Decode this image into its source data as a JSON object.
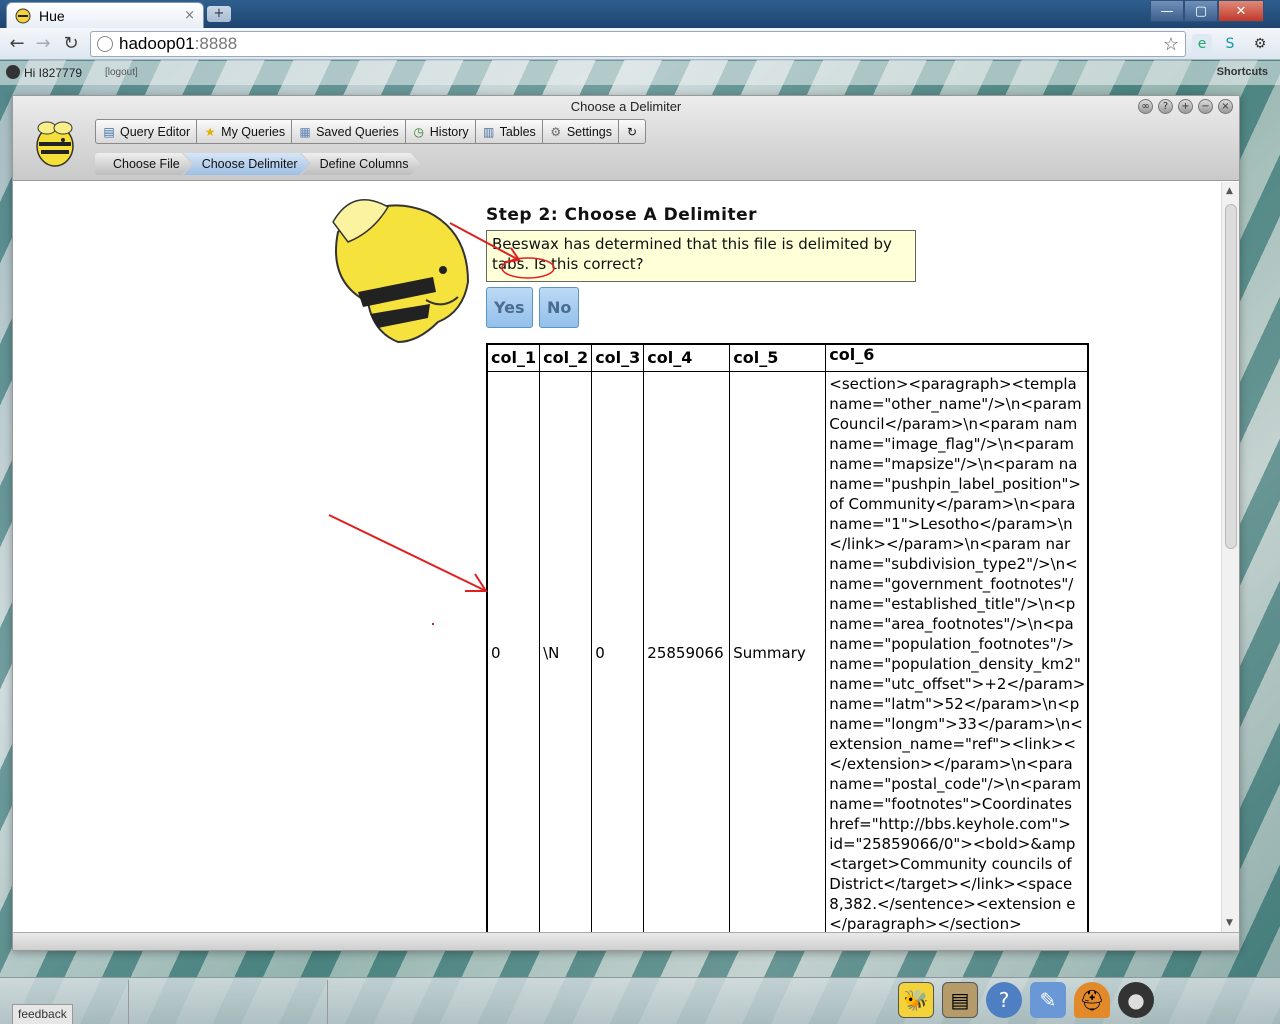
{
  "browser": {
    "tab_title": "Hue",
    "tab_close": "×",
    "new_tab": "+",
    "url_host": "hadoop01",
    "url_port": ":8888",
    "window_controls": [
      "—",
      "▢",
      "✕"
    ]
  },
  "hue_bar": {
    "greeting": "Hi I827779",
    "logout": "[logout]",
    "shortcuts": "Shortcuts"
  },
  "app": {
    "window_title": "Choose a Delimiter",
    "nav_tabs": [
      {
        "label": "Query Editor",
        "icon": "query-editor-icon"
      },
      {
        "label": "My Queries",
        "icon": "star-icon"
      },
      {
        "label": "Saved Queries",
        "icon": "saved-queries-icon"
      },
      {
        "label": "History",
        "icon": "clock-icon"
      },
      {
        "label": "Tables",
        "icon": "tables-icon"
      },
      {
        "label": "Settings",
        "icon": "gear-icon"
      }
    ],
    "breadcrumbs": [
      "Choose File",
      "Choose Delimiter",
      "Define Columns"
    ],
    "active_breadcrumb": "Choose Delimiter"
  },
  "wizard": {
    "step_title": "Step 2: Choose A Delimiter",
    "notice": "Beeswax has determined that this file is delimited by tabs. Is this correct?",
    "yes_label": "Yes",
    "no_label": "No"
  },
  "preview_table": {
    "headers": [
      "col_1",
      "col_2",
      "col_3",
      "col_4",
      "col_5",
      "col_6"
    ],
    "row": [
      "0",
      "\\N",
      "0",
      "25859066",
      "Summary"
    ],
    "col6_lines": [
      "<section><paragraph><templa",
      "name=\"other_name\"/>\\n<param",
      "Council</param>\\n<param nam",
      "name=\"image_flag\"/>\\n<param",
      "name=\"mapsize\"/>\\n<param na",
      "name=\"pushpin_label_position\">",
      "of Community</param>\\n<para",
      "name=\"1\">Lesotho</param>\\n",
      "</link></param>\\n<param nar",
      "name=\"subdivision_type2\"/>\\n<",
      "name=\"government_footnotes\"/",
      "name=\"established_title\"/>\\n<p",
      "name=\"area_footnotes\"/>\\n<pa",
      "name=\"population_footnotes\"/>",
      "name=\"population_density_km2\"",
      "name=\"utc_offset\">+2</param>",
      "name=\"latm\">52</param>\\n<p",
      "name=\"longm\">33</param>\\n<",
      "extension_name=\"ref\"><link><",
      "</extension></param>\\n<para",
      "name=\"postal_code\"/>\\n<param",
      "name=\"footnotes\">Coordinates",
      "href=\"http://bbs.keyhole.com\">",
      "id=\"25859066/0\"><bold>&amp",
      "<target>Community councils of",
      "District</target></link><space",
      "8,382.</sentence><extension e",
      "</paragraph></section>"
    ]
  },
  "dock": {
    "feedback": "feedback"
  },
  "colors": {
    "notice_bg": "#ffffd8",
    "button_bg": "#a8cdef",
    "active_crumb": "#9dbfe4",
    "annotation_red": "#e02020"
  }
}
